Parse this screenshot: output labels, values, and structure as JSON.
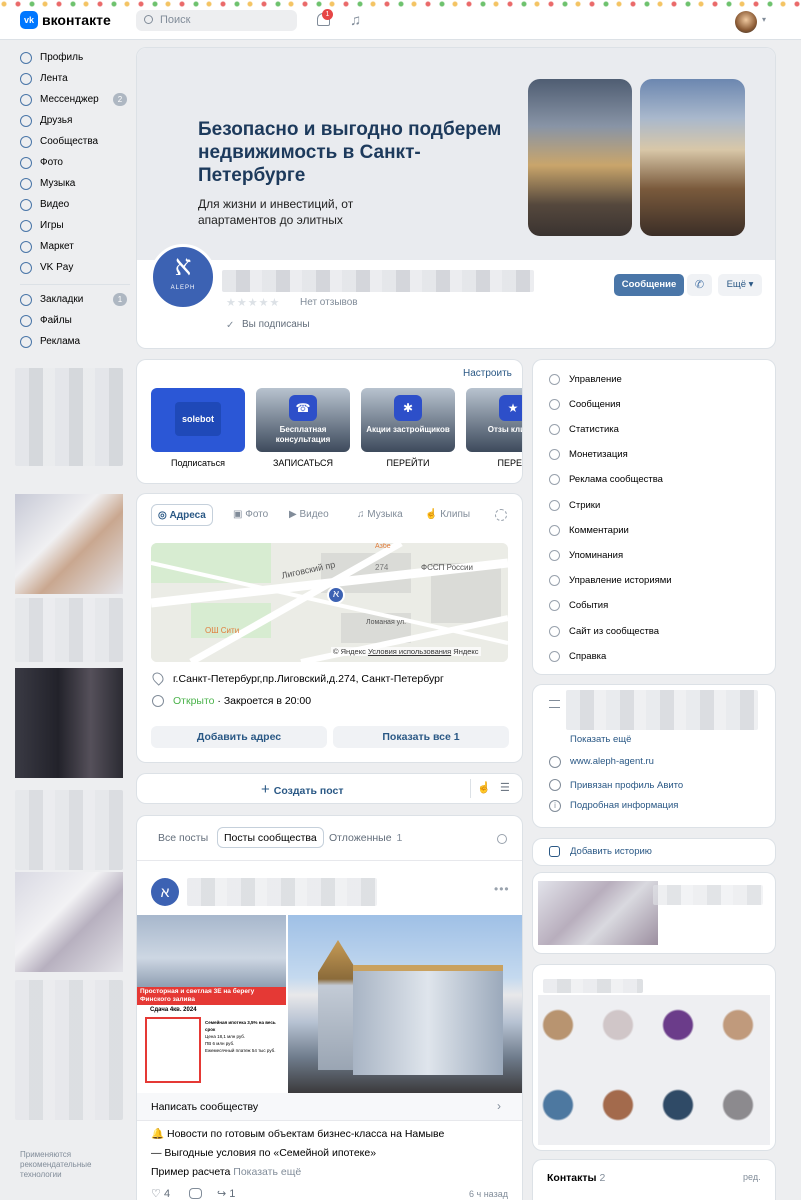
{
  "header": {
    "logo_text": "вконтакте",
    "search_placeholder": "Поиск",
    "notifications_count": "1",
    "accent": "#0077ff"
  },
  "left_nav": {
    "items": [
      {
        "label": "Профиль",
        "icon": "user-icon"
      },
      {
        "label": "Лента",
        "icon": "feed-icon"
      },
      {
        "label": "Мессенджер",
        "icon": "message-icon",
        "badge": "2"
      },
      {
        "label": "Друзья",
        "icon": "friends-icon"
      },
      {
        "label": "Сообщества",
        "icon": "groups-icon"
      },
      {
        "label": "Фото",
        "icon": "photo-icon"
      },
      {
        "label": "Музыка",
        "icon": "music-icon"
      },
      {
        "label": "Видео",
        "icon": "video-icon"
      },
      {
        "label": "Игры",
        "icon": "games-icon"
      },
      {
        "label": "Маркет",
        "icon": "market-icon"
      },
      {
        "label": "VK Pay",
        "icon": "vkpay-icon"
      }
    ],
    "items2": [
      {
        "label": "Закладки",
        "icon": "bookmark-icon",
        "badge": "1"
      },
      {
        "label": "Файлы",
        "icon": "file-icon"
      },
      {
        "label": "Реклама",
        "icon": "ads-icon"
      }
    ],
    "footer_text": "Применяются рекомендательные технологии"
  },
  "cover": {
    "headline": "Безопасно и выгодно подберем недвижимость в Санкт-Петербурге",
    "subline": "Для жизни и инвестиций, от апартаментов до элитных"
  },
  "profile": {
    "avatar_text": "ALEPH",
    "reviews": "Нет отзывов",
    "subscribed": "Вы подписаны",
    "message_button": "Сообщение",
    "more_button": "Ещё"
  },
  "widgets": {
    "configure": "Настроить",
    "items": [
      {
        "tile": "solebot",
        "caption": "Подписаться"
      },
      {
        "tile": "Бесплатная консультация",
        "caption": "ЗАПИСАТЬСЯ"
      },
      {
        "tile": "Акции застройщиков",
        "caption": "ПЕРЕЙТИ"
      },
      {
        "tile": "Отзы клиент",
        "caption": "ПЕРЕЙ"
      }
    ]
  },
  "address_tabs": [
    "Адреса",
    "Фото",
    "Видео",
    "Музыка",
    "Клипы"
  ],
  "map": {
    "street1": "Лиговский пр",
    "label_fssp": "ФССП России",
    "label_274": "274",
    "label_ampe": "Азбе",
    "label_osh": "ОШ Сити",
    "label_lomanaya": "Ломаная ул.",
    "copyright": "© Яндекс",
    "terms": "Условия использования",
    "yandex": "Яндекс"
  },
  "address": {
    "text": "г.Санкт-Петербург,пр.Лиговский,д.274, Санкт-Петербург",
    "status_open": "Открыто",
    "closes": "· Закроется в 20:00",
    "add_button": "Добавить адрес",
    "show_all_button": "Показать все 1"
  },
  "create_post": "Создать пост",
  "feed_tabs": {
    "all": "Все посты",
    "community": "Посты сообщества",
    "postponed": "Отложенные",
    "postponed_count": "1"
  },
  "post": {
    "ad_line1": "Просторная и светлая 3Е на берегу",
    "ad_line2": "Финского залива",
    "ad_line3": "Сдача 4кв. 2024",
    "ad_small1": "Семейная ипотека 3,5% на весь срок",
    "ad_small2": "Цена 18,1 млн руб.",
    "ad_small3": "ПВ 6 млн руб.",
    "ad_small4": "Ежемесячный платеж 54 тыс руб.",
    "write_community": "Написать сообществу",
    "text1": "🔔 Новости по готовым объектам бизнес-класса на Намыве",
    "text2": "— Выгодные условия по «Семейной ипотеке»",
    "text3": "Пример расчета",
    "show_more": "Показать ещё",
    "likes": "4",
    "reposts": "1",
    "time": "6 ч назад"
  },
  "manage_menu": [
    "Управление",
    "Сообщения",
    "Статистика",
    "Монетизация",
    "Реклама сообщества",
    "Стрики",
    "Комментарии",
    "Упоминания",
    "Управление историями",
    "События",
    "Сайт из сообщества",
    "Справка"
  ],
  "info": {
    "show_more": "Показать ещё",
    "website": "www.aleph-agent.ru",
    "avito": "Привязан профиль Авито",
    "details": "Подробная информация"
  },
  "add_story": "Добавить историю",
  "contacts": {
    "label": "Контакты",
    "count": "2",
    "edit": "ред."
  }
}
